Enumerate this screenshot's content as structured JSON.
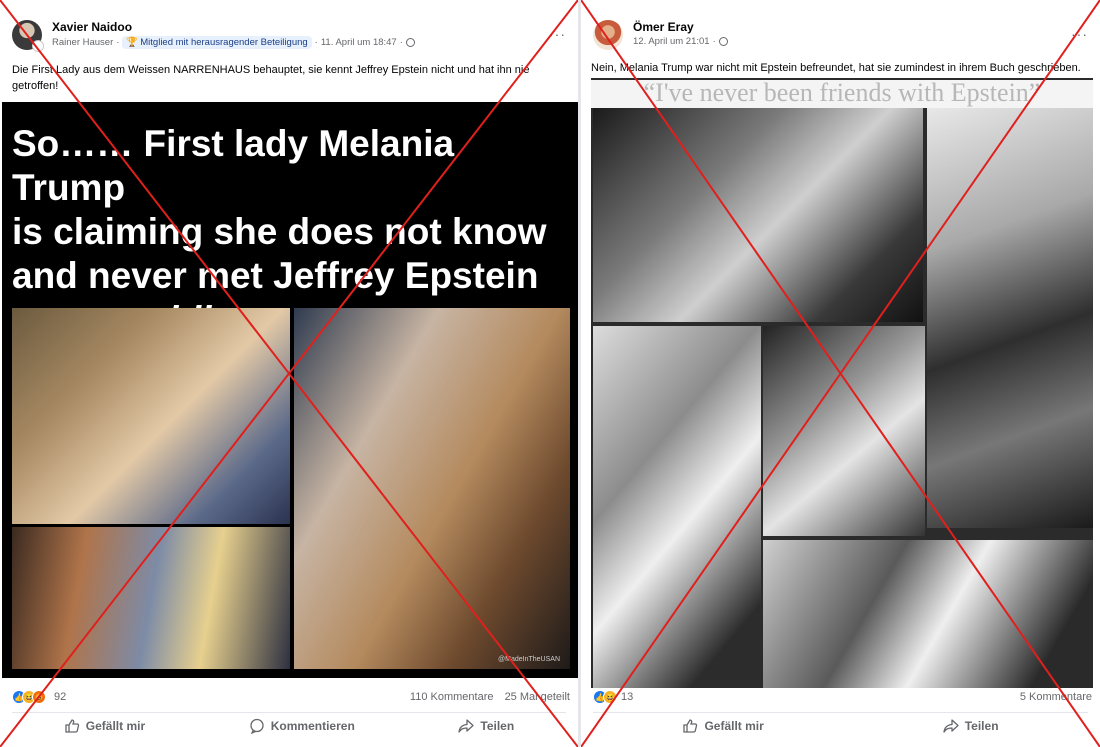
{
  "left_post": {
    "author": "Xavier Naidoo",
    "shared_by": "Rainer Hauser",
    "member_badge": "Mitglied mit herausragender Beteiligung",
    "date": "11. April um 18:47",
    "caption": "Die First Lady aus dem Weissen NARRENHAUS behauptet, sie kennt Jeffrey Epstein nicht und hat ihn nie getroffen!",
    "image_headline_line1": "So…… First lady Melania Trump",
    "image_headline_line2": "is claiming she does not know",
    "image_headline_line3": "and never met Jeffrey Epstein",
    "image_headline_prefix": "– ",
    "image_headline_emph": "meanwhile",
    "image_headline_suffix": ":",
    "watermark": "@MadeInTheUSAN",
    "reaction_count": "92",
    "comments": "110 Kommentare",
    "shares": "25 Mal geteilt",
    "actions": {
      "like": "Gefällt mir",
      "comment": "Kommentieren",
      "share": "Teilen"
    }
  },
  "right_post": {
    "author": "Ömer Eray",
    "date": "12. April um 21:01",
    "caption": "Nein, Melania Trump war nicht mit Epstein befreundet, hat sie zumindest in ihrem Buch geschrieben.",
    "image_quote": "“I've never been friends with Epstein”",
    "reaction_count": "13",
    "comments": "5 Kommentare",
    "actions": {
      "like": "Gefällt mir",
      "share": "Teilen"
    }
  },
  "icons": [
    "more-icon",
    "globe-icon",
    "trophy-icon",
    "like-icon",
    "comment-icon",
    "share-icon",
    "red-cross-icon"
  ],
  "colors": {
    "cross": "#e0201d",
    "like_blue": "#1877f2",
    "meta_gray": "#65676b"
  }
}
